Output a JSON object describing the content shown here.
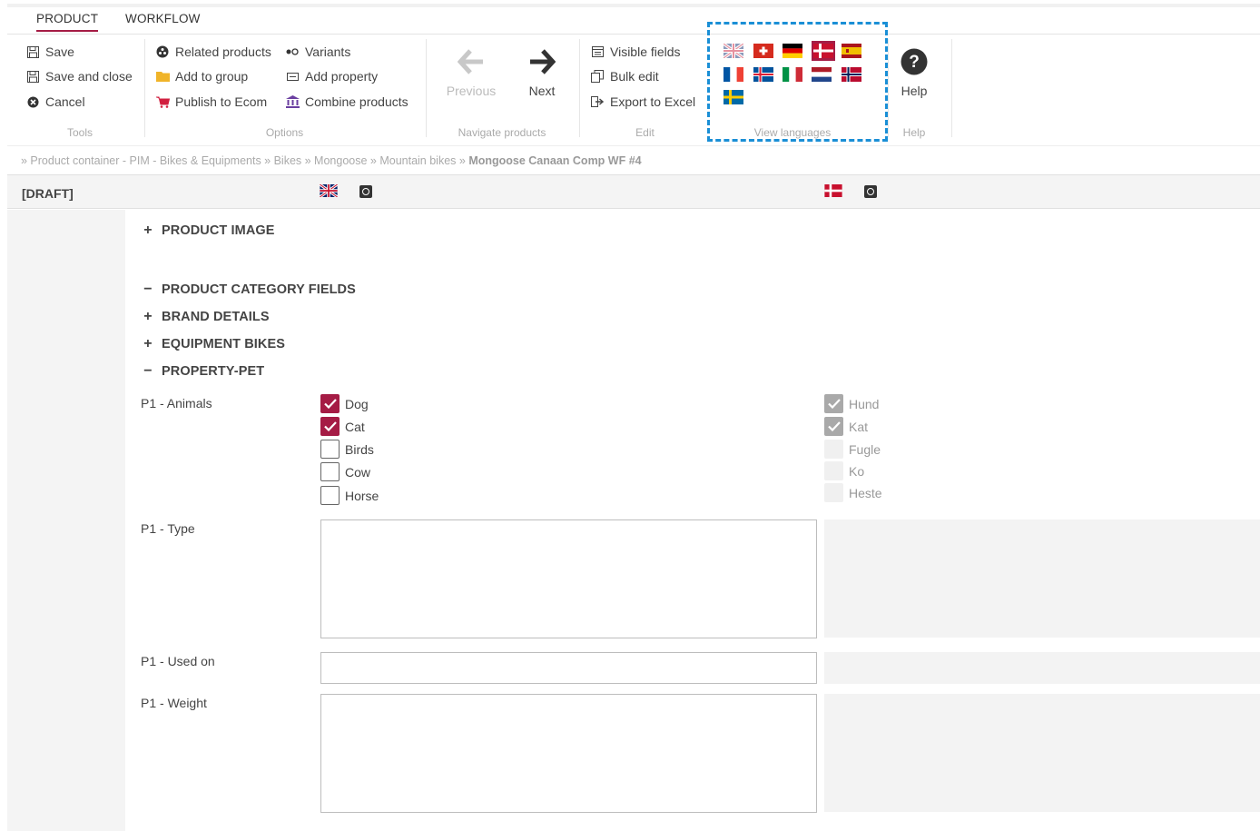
{
  "tabs": [
    {
      "label": "PRODUCT",
      "active": true
    },
    {
      "label": "WORKFLOW",
      "active": false
    }
  ],
  "ribbon": {
    "tools": {
      "save": "Save",
      "save_close": "Save and close",
      "cancel": "Cancel",
      "group_label": "Tools"
    },
    "options": {
      "related": "Related products",
      "variants": "Variants",
      "add_group": "Add to group",
      "add_property": "Add property",
      "publish": "Publish to Ecom",
      "combine": "Combine products",
      "group_label": "Options"
    },
    "navigate": {
      "previous": "Previous",
      "next": "Next",
      "group_label": "Navigate products"
    },
    "edit": {
      "visible_fields": "Visible fields",
      "bulk_edit": "Bulk edit",
      "export_excel": "Export to Excel",
      "group_label": "Edit"
    },
    "languages": {
      "group_label": "View languages",
      "flags": [
        "uk-flag-icon",
        "swiss-flag-icon",
        "german-flag-icon",
        "danish-flag-icon",
        "spanish-flag-icon",
        "french-flag-icon",
        "icelandic-flag-icon",
        "italian-flag-icon",
        "dutch-flag-icon",
        "norwegian-flag-icon",
        "swedish-flag-icon"
      ]
    },
    "help": {
      "label": "Help",
      "group_label": "Help"
    }
  },
  "breadcrumb": {
    "path": "» Product container - PIM - Bikes & Equipments » Bikes » Mongoose » Mountain bikes » ",
    "current": "Mongoose Canaan Comp WF #4"
  },
  "status": "[DRAFT]",
  "sections": {
    "product_image": "PRODUCT IMAGE",
    "category_fields": "PRODUCT CATEGORY FIELDS",
    "brand_details": "BRAND DETAILS",
    "equipment_bikes": "EQUIPMENT BIKES",
    "property_pet": "PROPERTY-PET"
  },
  "fields": {
    "animals_label": "P1 - Animals",
    "type_label": "P1 - Type",
    "used_on_label": "P1 - Used on",
    "weight_label": "P1 - Weight"
  },
  "animals_en": [
    {
      "label": "Dog",
      "checked": true
    },
    {
      "label": "Cat",
      "checked": true
    },
    {
      "label": "Birds",
      "checked": false
    },
    {
      "label": "Cow",
      "checked": false
    },
    {
      "label": "Horse",
      "checked": false
    }
  ],
  "animals_da": [
    {
      "label": "Hund",
      "checked": true
    },
    {
      "label": "Kat",
      "checked": true
    },
    {
      "label": "Fugle",
      "checked": false
    },
    {
      "label": "Ko",
      "checked": false
    },
    {
      "label": "Heste",
      "checked": false
    }
  ],
  "colors": {
    "accent": "#a51c45",
    "highlight_outline": "#1a8fd6"
  }
}
